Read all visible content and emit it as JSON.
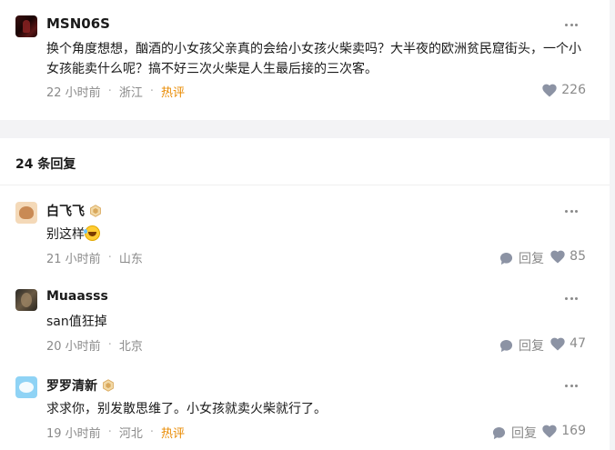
{
  "post": {
    "username": "MSN06S",
    "content": "换个角度想想，酗酒的小女孩父亲真的会给小女孩火柴卖吗？大半夜的欧洲贫民窟街头，一个小女孩能卖什么呢？搞不好三次火柴是人生最后接的三次客。",
    "time": "22 小时前",
    "location": "浙江",
    "tag": "热评",
    "likes": "226"
  },
  "replies_header": "24 条回复",
  "reply_label": "回复",
  "colors": {
    "hot": "#e98a00",
    "meta": "#8a8a8a",
    "icon": "#8c93a4",
    "divider_bg": "#f3f3f5"
  },
  "icons": {
    "more": "more-dots-icon",
    "like": "heart-icon",
    "reply": "comment-bubble-icon",
    "badge": "vip-badge-icon",
    "emoji": "laughing-emoji-icon"
  },
  "replies": [
    {
      "username": "白飞飞",
      "badge": true,
      "content": "别这样",
      "emoji": true,
      "time": "21 小时前",
      "location": "山东",
      "tag": "",
      "likes": "85"
    },
    {
      "username": "Muaasss",
      "badge": false,
      "content": "san值狂掉",
      "emoji": false,
      "time": "20 小时前",
      "location": "北京",
      "tag": "",
      "likes": "47"
    },
    {
      "username": "罗罗清新",
      "badge": true,
      "content": "求求你，别发散思维了。小女孩就卖火柴就行了。",
      "emoji": false,
      "time": "19 小时前",
      "location": "河北",
      "tag": "热评",
      "likes": "169"
    }
  ]
}
